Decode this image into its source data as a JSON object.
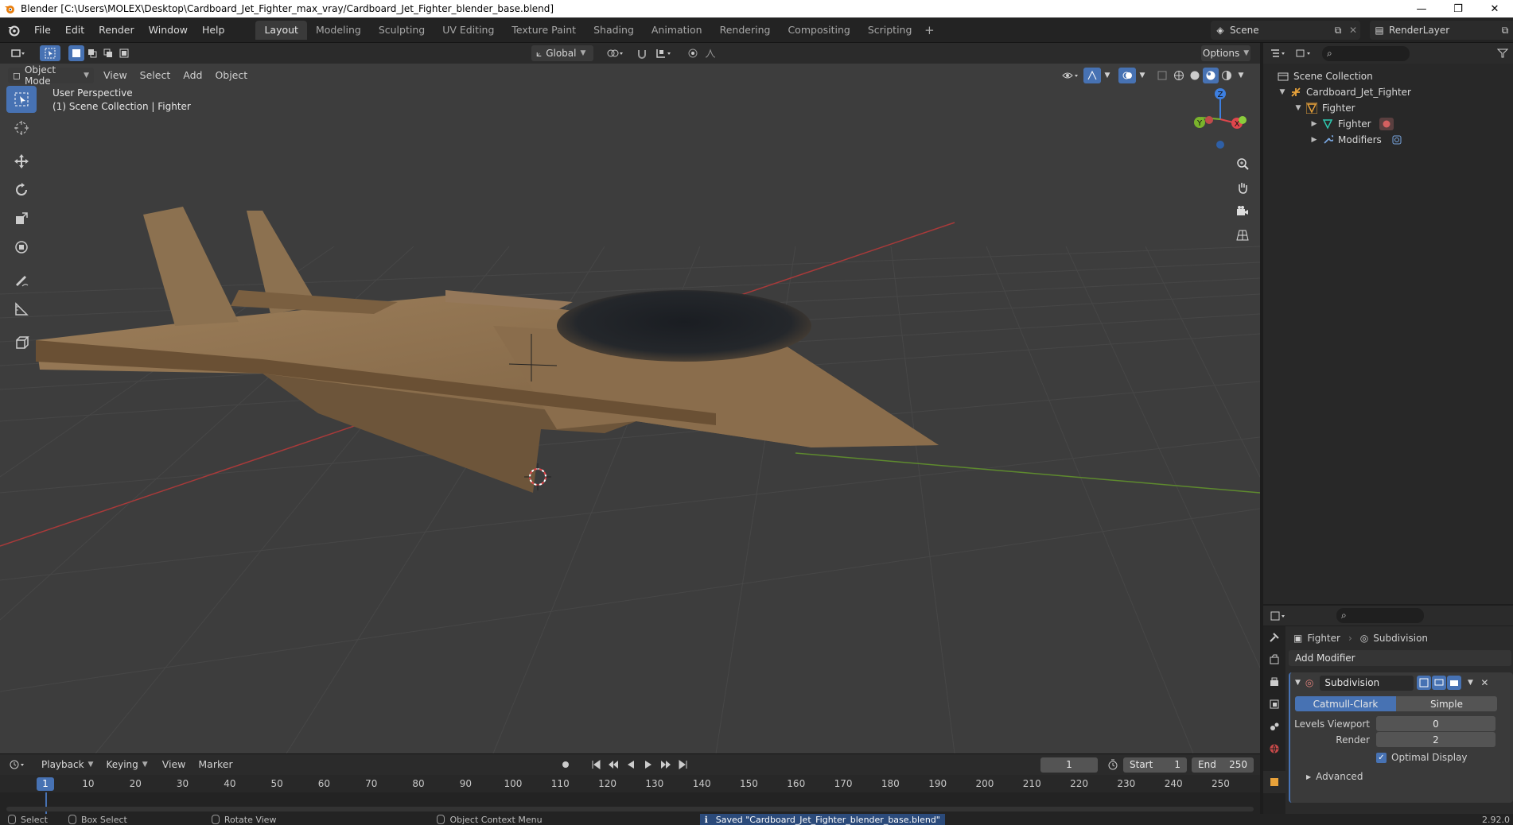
{
  "window": {
    "title": "Blender [C:\\Users\\MOLEX\\Desktop\\Cardboard_Jet_Fighter_max_vray/Cardboard_Jet_Fighter_blender_base.blend]",
    "minimize": "—",
    "maximize": "❐",
    "close": "✕"
  },
  "menu": [
    "File",
    "Edit",
    "Render",
    "Window",
    "Help"
  ],
  "workspaces": [
    "Layout",
    "Modeling",
    "Sculpting",
    "UV Editing",
    "Texture Paint",
    "Shading",
    "Animation",
    "Rendering",
    "Compositing",
    "Scripting"
  ],
  "active_workspace": "Layout",
  "scene": {
    "name": "Scene",
    "render_layer": "RenderLayer"
  },
  "viewport_header": {
    "mode": "Object Mode",
    "menus": [
      "View",
      "Select",
      "Add",
      "Object"
    ],
    "orientation": "Global",
    "options": "Options"
  },
  "viewport": {
    "perspective": "User Perspective",
    "collection": "(1) Scene Collection | Fighter",
    "gizmo_axes": {
      "x": "X",
      "y": "Y",
      "z": "Z"
    }
  },
  "colors": {
    "accent": "#4772b3",
    "x_axis": "#e0464c",
    "y_axis": "#7ab32c",
    "z_axis": "#3d7fe0",
    "cardboard": "#8b6f4e"
  },
  "outliner": {
    "rows": [
      {
        "label": "Scene Collection",
        "icon": "collection-icon"
      },
      {
        "label": "Cardboard_Jet_Fighter",
        "icon": "armature-icon"
      },
      {
        "label": "Fighter",
        "icon": "object-icon"
      },
      {
        "label": "Fighter",
        "icon": "mesh-icon"
      },
      {
        "label": "Modifiers",
        "icon": "wrench-icon"
      }
    ]
  },
  "properties": {
    "breadcrumb_object": "Fighter",
    "breadcrumb_modifier": "Subdivision",
    "add_modifier": "Add Modifier",
    "modifier_name": "Subdivision",
    "type_a": "Catmull-Clark",
    "type_b": "Simple",
    "levels_viewport_label": "Levels Viewport",
    "levels_viewport_value": "0",
    "render_label": "Render",
    "render_value": "2",
    "optimal_display": "Optimal Display",
    "advanced": "Advanced"
  },
  "timeline": {
    "menus": [
      "Playback",
      "Keying",
      "View",
      "Marker"
    ],
    "current_frame": "1",
    "start_label": "Start",
    "start_value": "1",
    "end_label": "End",
    "end_value": "250",
    "ruler": [
      "10",
      "20",
      "30",
      "40",
      "50",
      "60",
      "70",
      "80",
      "90",
      "100",
      "110",
      "120",
      "130",
      "140",
      "150",
      "160",
      "170",
      "180",
      "190",
      "200",
      "210",
      "220",
      "230",
      "240",
      "250"
    ],
    "ruler_current": "1"
  },
  "status": {
    "select": "Select",
    "box_select": "Box Select",
    "rotate_view": "Rotate View",
    "context_menu": "Object Context Menu",
    "message": "Saved \"Cardboard_Jet_Fighter_blender_base.blend\"",
    "version": "2.92.0"
  }
}
